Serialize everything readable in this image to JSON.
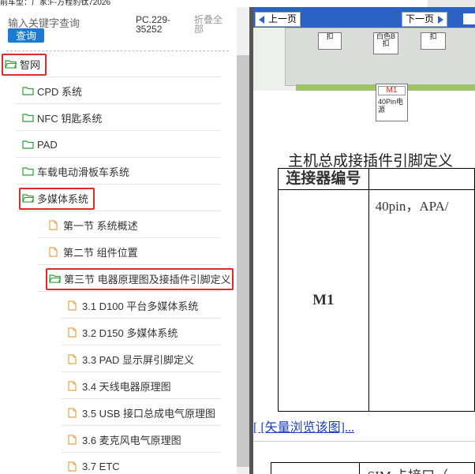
{
  "top_bar": {
    "text": "前车型：厂家:F-方程豹钛72026"
  },
  "left_panel": {
    "search_hint": "输入关键字查询",
    "search_button": "查询",
    "pc_code": "PC.229-35252",
    "collapse_all": "折叠全部",
    "tree": [
      {
        "label": "智网",
        "level": 0,
        "icon": "folder-open-icon",
        "highlighted": true
      },
      {
        "label": "CPD 系统",
        "level": 1,
        "icon": "folder-icon"
      },
      {
        "label": "NFC 钥匙系统",
        "level": 1,
        "icon": "folder-icon"
      },
      {
        "label": "PAD",
        "level": 1,
        "icon": "folder-icon"
      },
      {
        "label": "车载电动滑板车系统",
        "level": 1,
        "icon": "folder-icon"
      },
      {
        "label": "多媒体系统",
        "level": 1,
        "icon": "folder-open-icon",
        "highlighted": true
      },
      {
        "label": "第一节 系统概述",
        "level": 2,
        "icon": "document-icon"
      },
      {
        "label": "第二节 组件位置",
        "level": 2,
        "icon": "document-icon"
      },
      {
        "label": "第三节 电器原理图及接插件引脚定义",
        "level": 2,
        "icon": "folder-open-icon",
        "highlighted": true
      },
      {
        "label": "3.1 D100 平台多媒体系统",
        "level": 3,
        "icon": "document-icon"
      },
      {
        "label": "3.2 D150 多媒体系统",
        "level": 3,
        "icon": "document-icon"
      },
      {
        "label": "3.3 PAD 显示屏引脚定义",
        "level": 3,
        "icon": "document-icon"
      },
      {
        "label": "3.4 天线电器原理图",
        "level": 3,
        "icon": "document-icon"
      },
      {
        "label": "3.5 USB 接口总成电气原理图",
        "level": 3,
        "icon": "document-icon"
      },
      {
        "label": "3.6 麦克风电气原理图",
        "level": 3,
        "icon": "document-icon"
      },
      {
        "label": "3.7 ETC",
        "level": 3,
        "icon": "document-icon"
      }
    ]
  },
  "right_panel": {
    "nav": {
      "prev": "上一页",
      "next": "下一页"
    },
    "diagram_labels": {
      "left_clip": "扣",
      "white_b_clip": "白色B扣",
      "right_clip": "扣",
      "callout_id": "M1",
      "callout_desc": "40Pin电源"
    },
    "section_title": "主机总成接插件引脚定义",
    "table": {
      "header": "连接器编号",
      "connector": "M1",
      "desc": "40pin，APA/"
    },
    "vector_link": "[ [矢量浏览该图]...",
    "sim_table_fragment": "SIM 卡接口（"
  },
  "colors": {
    "accent_blue": "#2d62c5",
    "search_button_blue": "#1a7ad4",
    "highlight_red": "#e02a2a",
    "folder_green": "#2e9e3a",
    "doc_orange": "#e8a24a"
  }
}
